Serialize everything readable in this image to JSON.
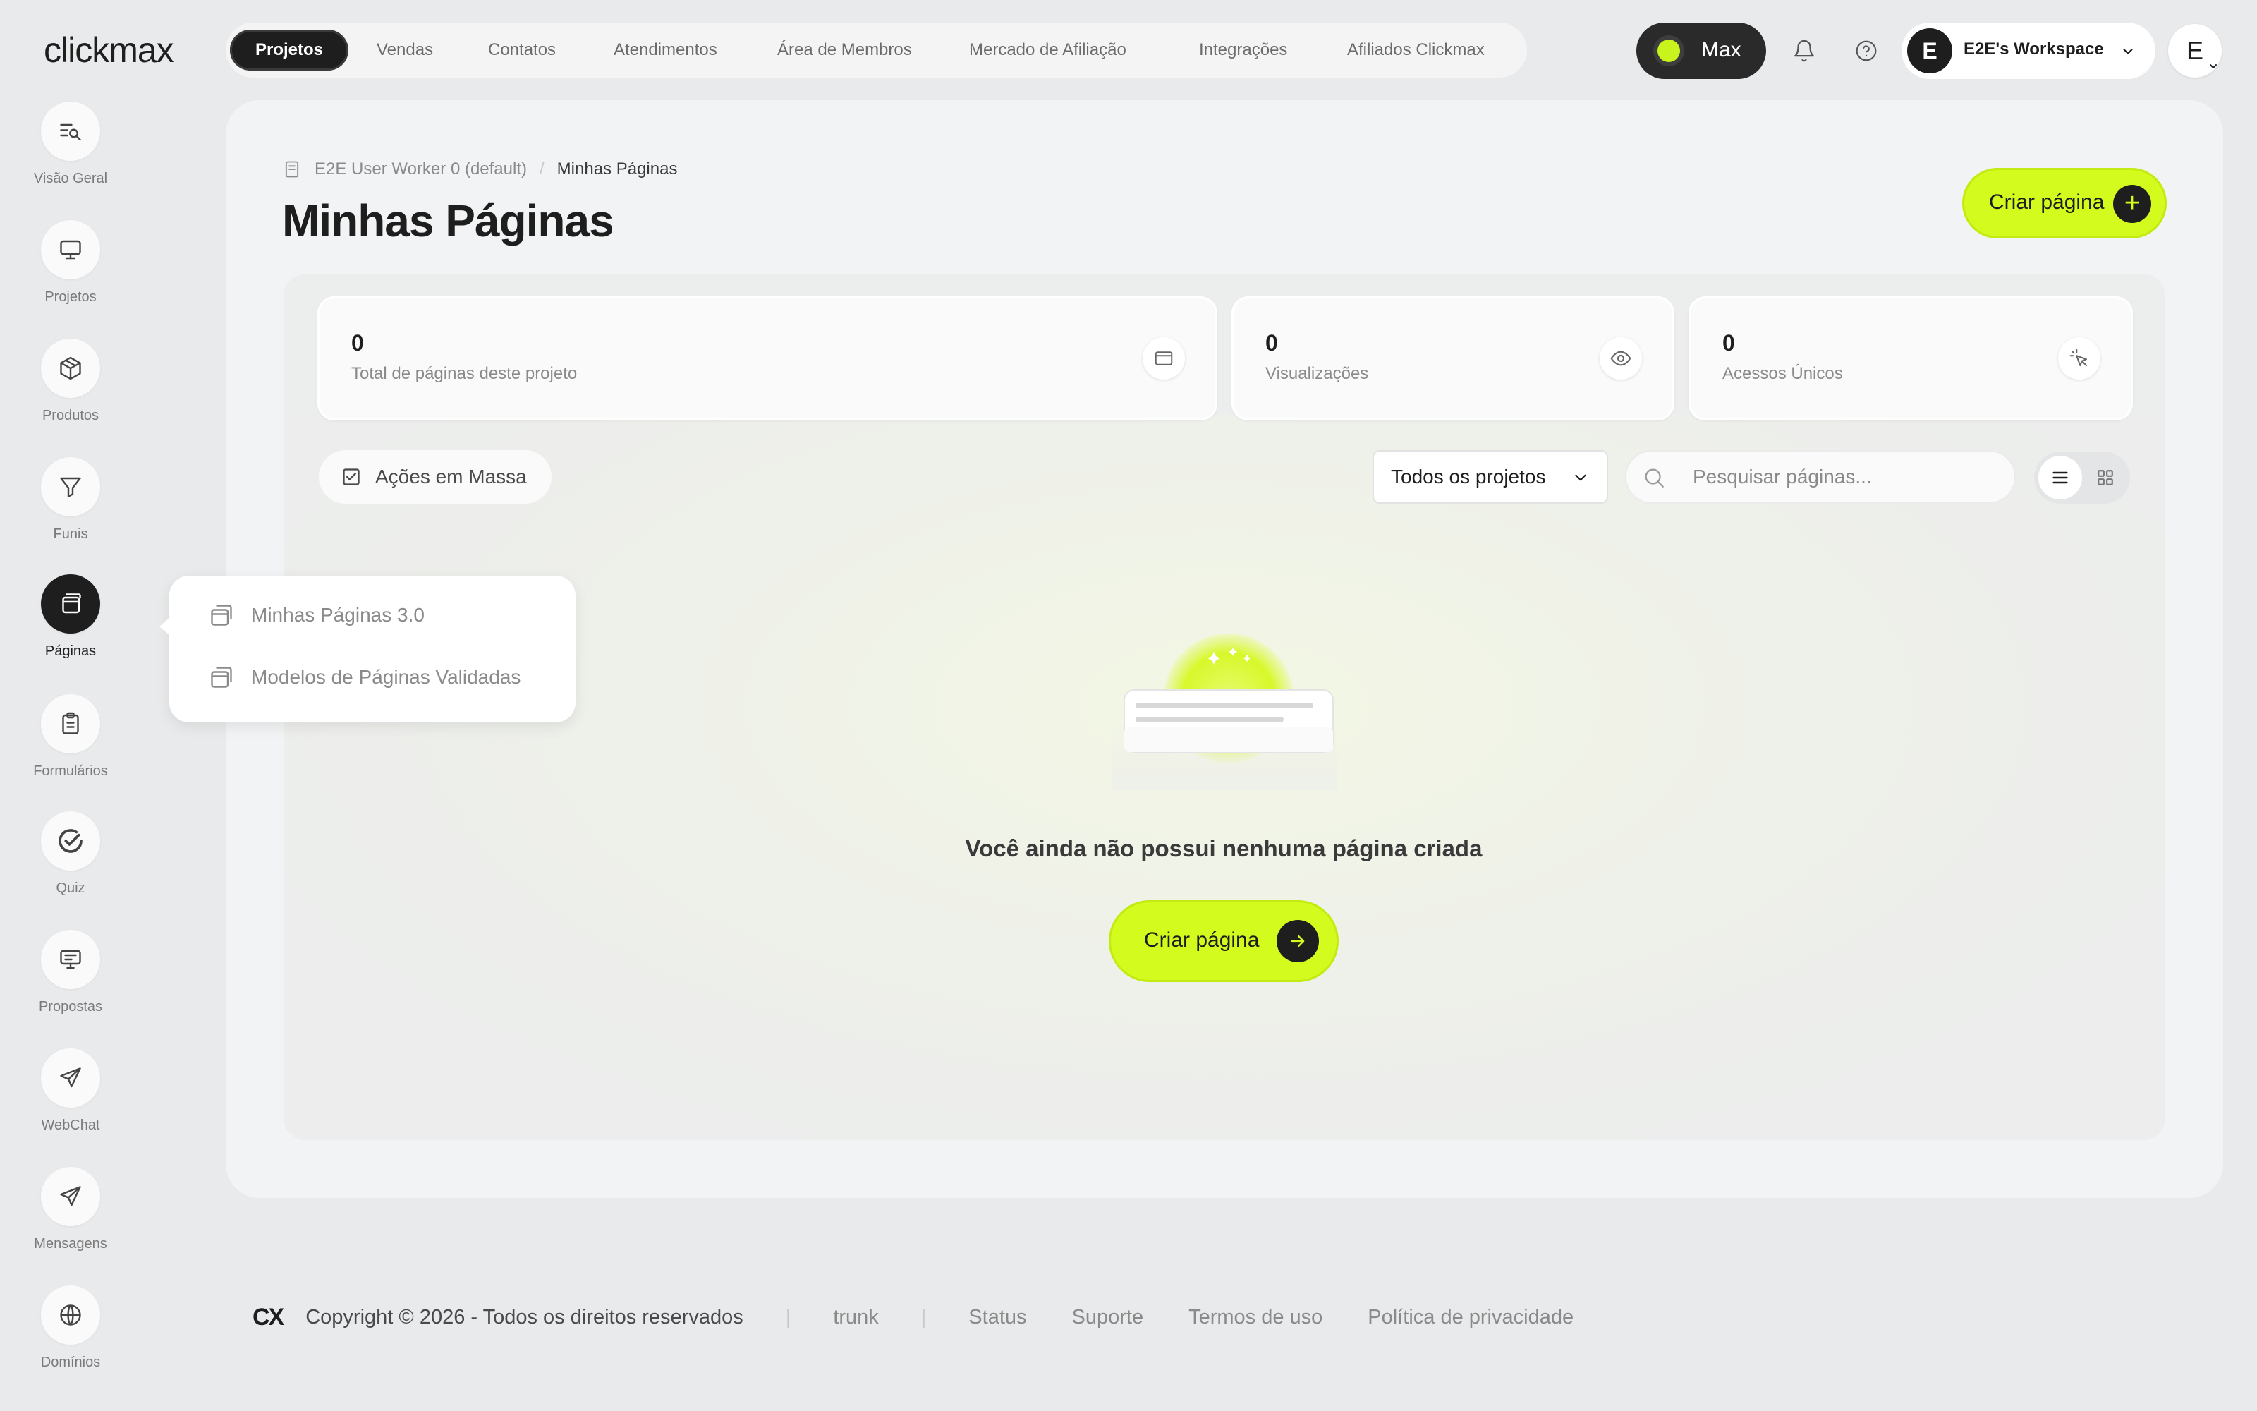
{
  "brand": {
    "logo_text": "clickmax",
    "footer_logo": "CX"
  },
  "topnav": {
    "tabs": [
      {
        "label": "Projetos",
        "active": true
      },
      {
        "label": "Vendas"
      },
      {
        "label": "Contatos"
      },
      {
        "label": "Atendimentos"
      },
      {
        "label": "Área de Membros"
      },
      {
        "label": "Mercado de Afiliação"
      },
      {
        "label": "Integrações"
      },
      {
        "label": "Afiliados Clickmax"
      }
    ],
    "plan_label": "Max",
    "workspace_initial": "E",
    "workspace_label": "E2E's Workspace",
    "user_initial": "E"
  },
  "sidebar": {
    "items": [
      {
        "label": "Visão Geral",
        "icon": "search-list-icon"
      },
      {
        "label": "Projetos",
        "icon": "monitor-icon"
      },
      {
        "label": "Produtos",
        "icon": "box-icon"
      },
      {
        "label": "Funis",
        "icon": "funnel-icon"
      },
      {
        "label": "Páginas",
        "icon": "pages-icon",
        "active": true
      },
      {
        "label": "Formulários",
        "icon": "clipboard-icon"
      },
      {
        "label": "Quiz",
        "icon": "check-circle-icon"
      },
      {
        "label": "Propostas",
        "icon": "presentation-icon"
      },
      {
        "label": "WebChat",
        "icon": "send-icon"
      },
      {
        "label": "Mensagens",
        "icon": "send-icon"
      },
      {
        "label": "Domínios",
        "icon": "globe-icon"
      }
    ]
  },
  "flyout": {
    "items": [
      {
        "label": "Minhas Páginas 3.0"
      },
      {
        "label": "Modelos de Páginas Validadas"
      }
    ]
  },
  "page": {
    "breadcrumb": {
      "project": "E2E User Worker 0 (default)",
      "separator": "/",
      "current": "Minhas Páginas"
    },
    "title": "Minhas Páginas",
    "create_button": "Criar página"
  },
  "stats": [
    {
      "value": "0",
      "label": "Total de páginas deste projeto",
      "icon": "browser-icon"
    },
    {
      "value": "0",
      "label": "Visualizações",
      "icon": "eye-icon"
    },
    {
      "value": "0",
      "label": "Acessos Únicos",
      "icon": "cursor-click-icon"
    }
  ],
  "toolbar": {
    "bulk_actions": "Ações em Massa",
    "project_filter": "Todos os projetos",
    "search_placeholder": "Pesquisar páginas..."
  },
  "empty_state": {
    "message": "Você ainda não possui nenhuma página criada",
    "button": "Criar página"
  },
  "footer": {
    "copyright": "Copyright © 2026 - Todos os direitos reservados",
    "branch": "trunk",
    "links": [
      "Status",
      "Suporte",
      "Termos de uso",
      "Política de privacidade"
    ]
  },
  "colors": {
    "accent": "#d4fb1e",
    "dark": "#1e1e1e",
    "background": "#e9eaeb"
  }
}
